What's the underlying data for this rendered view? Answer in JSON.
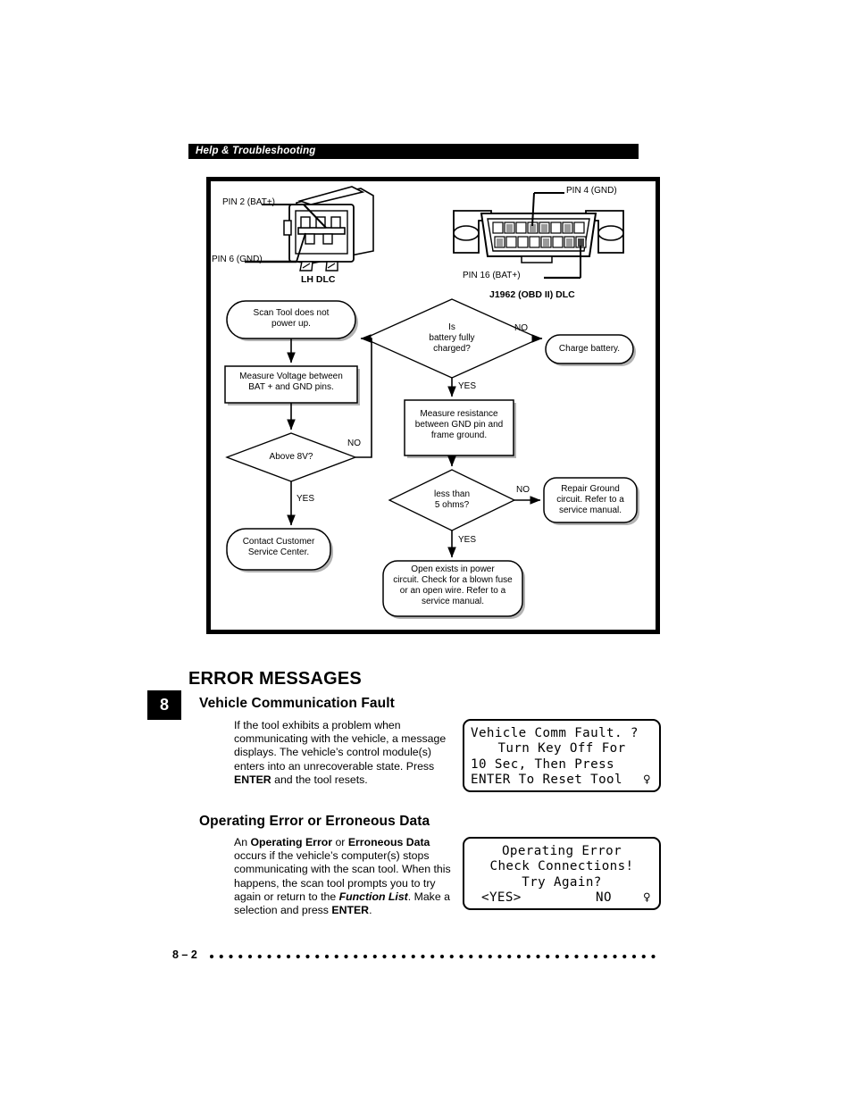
{
  "page": {
    "header_title": "Help & Troubleshooting",
    "chapter_number": "8",
    "footer_page": "8 – 2"
  },
  "figure": {
    "connectors": [
      {
        "name": "lh-dlc",
        "caption": "LH DLC",
        "callouts": [
          {
            "name": "pin-2-bat-plus",
            "text": "PIN 2 (BAT+)"
          },
          {
            "name": "pin-6-gnd",
            "text": "PIN 6 (GND)"
          }
        ]
      },
      {
        "name": "j1962-obd-ii-dlc",
        "caption": "J1962 (OBD II) DLC",
        "callouts": [
          {
            "name": "pin-4-gnd",
            "text": "PIN 4 (GND)"
          },
          {
            "name": "pin-16-bat-plus",
            "text": "PIN 16 (BAT+)"
          }
        ]
      }
    ],
    "flowchart": {
      "nodes": [
        {
          "id": "start",
          "shape": "terminator",
          "text": "Scan Tool does not\npower up."
        },
        {
          "id": "measure-voltage",
          "shape": "process",
          "text": "Measure Voltage between\nBAT + and GND pins."
        },
        {
          "id": "above-8v",
          "shape": "decision",
          "text": "Above 8V?"
        },
        {
          "id": "contact-service",
          "shape": "terminator",
          "text": "Contact Customer\nService Center."
        },
        {
          "id": "battery-charged",
          "shape": "decision",
          "text": "Is\nbattery fully\ncharged?"
        },
        {
          "id": "charge-battery",
          "shape": "terminator",
          "text": "Charge battery."
        },
        {
          "id": "measure-resistance",
          "shape": "process",
          "text": "Measure resistance\nbetween GND pin and\nframe ground."
        },
        {
          "id": "less-than-5-ohms",
          "shape": "decision",
          "text": "less than\n5 ohms?"
        },
        {
          "id": "repair-ground",
          "shape": "terminator",
          "text": "Repair Ground\ncircuit. Refer to a\nservice manual."
        },
        {
          "id": "open-in-power",
          "shape": "terminator",
          "text": "Open exists in power\ncircuit. Check for a blown fuse\nor an open wire. Refer to a\nservice manual."
        }
      ],
      "edge_labels": [
        {
          "id": "above-8v-no",
          "text": "NO"
        },
        {
          "id": "above-8v-yes",
          "text": "YES"
        },
        {
          "id": "battery-charged-no",
          "text": "NO"
        },
        {
          "id": "battery-charged-yes",
          "text": "YES"
        },
        {
          "id": "less-than-5-ohms-no",
          "text": "NO"
        },
        {
          "id": "less-than-5-ohms-yes",
          "text": "YES"
        }
      ]
    }
  },
  "content": {
    "section_title": "ERROR MESSAGES",
    "subsections": [
      {
        "id": "vehicle-communication-fault",
        "heading": "Vehicle Communication Fault",
        "body_html": "If the tool exhibits a problem when communicating with the vehicle, a message displays. The vehicle’s control module(s) enters into an unrecoverable state. Press <b>ENTER</b> and the tool resets."
      },
      {
        "id": "operating-error-or-erroneous-data",
        "heading": "Operating Error or Erroneous Data",
        "body_html": "An <b>Operating Error</b> or <b>Erroneous Data</b> occurs if the vehicle’s computer(s) stops communicating with the scan tool. When this happens, the scan tool prompts you to try again or return to the <i class=\"bi\">Function List</i>. Make a selection and press <b>ENTER</b>."
      }
    ]
  },
  "lcd_screens": [
    {
      "id": "vehicle-comm-fault-screen",
      "lines": [
        {
          "text": "Vehicle Comm Fault. ?",
          "align": "left"
        },
        {
          "text": "Turn Key Off For",
          "align": "center"
        },
        {
          "text": "10 Sec, Then Press",
          "align": "left"
        },
        {
          "text": "ENTER To Reset Tool",
          "align": "left",
          "arrow": "♀"
        }
      ]
    },
    {
      "id": "operating-error-screen",
      "lines": [
        {
          "text": "Operating Error",
          "align": "center"
        },
        {
          "text": "Check Connections!",
          "align": "center"
        },
        {
          "text": "Try Again?",
          "align": "center"
        },
        {
          "split": true,
          "yes": "<YES>",
          "no": "NO",
          "arrow": "♀"
        }
      ]
    }
  ],
  "colors": {
    "ink": "#000000",
    "paper": "#ffffff",
    "shadow": "#b3b3b3"
  }
}
